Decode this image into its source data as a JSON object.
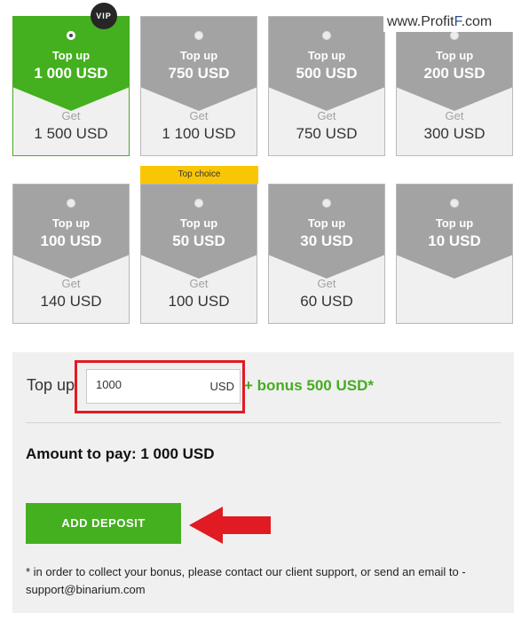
{
  "watermark": {
    "prefix": "www.Profit",
    "mid": "F",
    "suffix": ".com"
  },
  "vip_badge": "VIP",
  "top_choice_label": "Top choice",
  "cards": [
    {
      "top_label": "Top up",
      "amount": "1 000 USD",
      "get_label": "Get",
      "get_amount": "1 500 USD",
      "selected": true
    },
    {
      "top_label": "Top up",
      "amount": "750 USD",
      "get_label": "Get",
      "get_amount": "1 100 USD",
      "selected": false
    },
    {
      "top_label": "Top up",
      "amount": "500 USD",
      "get_label": "Get",
      "get_amount": "750 USD",
      "selected": false
    },
    {
      "top_label": "Top up",
      "amount": "200 USD",
      "get_label": "Get",
      "get_amount": "300 USD",
      "selected": false
    },
    {
      "top_label": "Top up",
      "amount": "100 USD",
      "get_label": "Get",
      "get_amount": "140 USD",
      "selected": false
    },
    {
      "top_label": "Top up",
      "amount": "50 USD",
      "get_label": "Get",
      "get_amount": "100 USD",
      "selected": false
    },
    {
      "top_label": "Top up",
      "amount": "30 USD",
      "get_label": "Get",
      "get_amount": "60 USD",
      "selected": false
    },
    {
      "top_label": "Top up",
      "amount": "10 USD",
      "get_label": "",
      "get_amount": "",
      "selected": false
    }
  ],
  "form": {
    "topup_label": "Top up",
    "input_value": "1000",
    "currency": "USD",
    "bonus_text": "+ bonus 500 USD*",
    "amount_to_pay": "Amount to pay: 1 000 USD",
    "button_label": "ADD DEPOSIT",
    "footnote": "* in order to collect your bonus, please contact our client support, or send an email to - support@binarium.com"
  },
  "colors": {
    "accent": "#44b01f",
    "card_gray": "#a3a3a3",
    "highlight_red": "#e01b23",
    "badge_yellow": "#f9c606"
  }
}
